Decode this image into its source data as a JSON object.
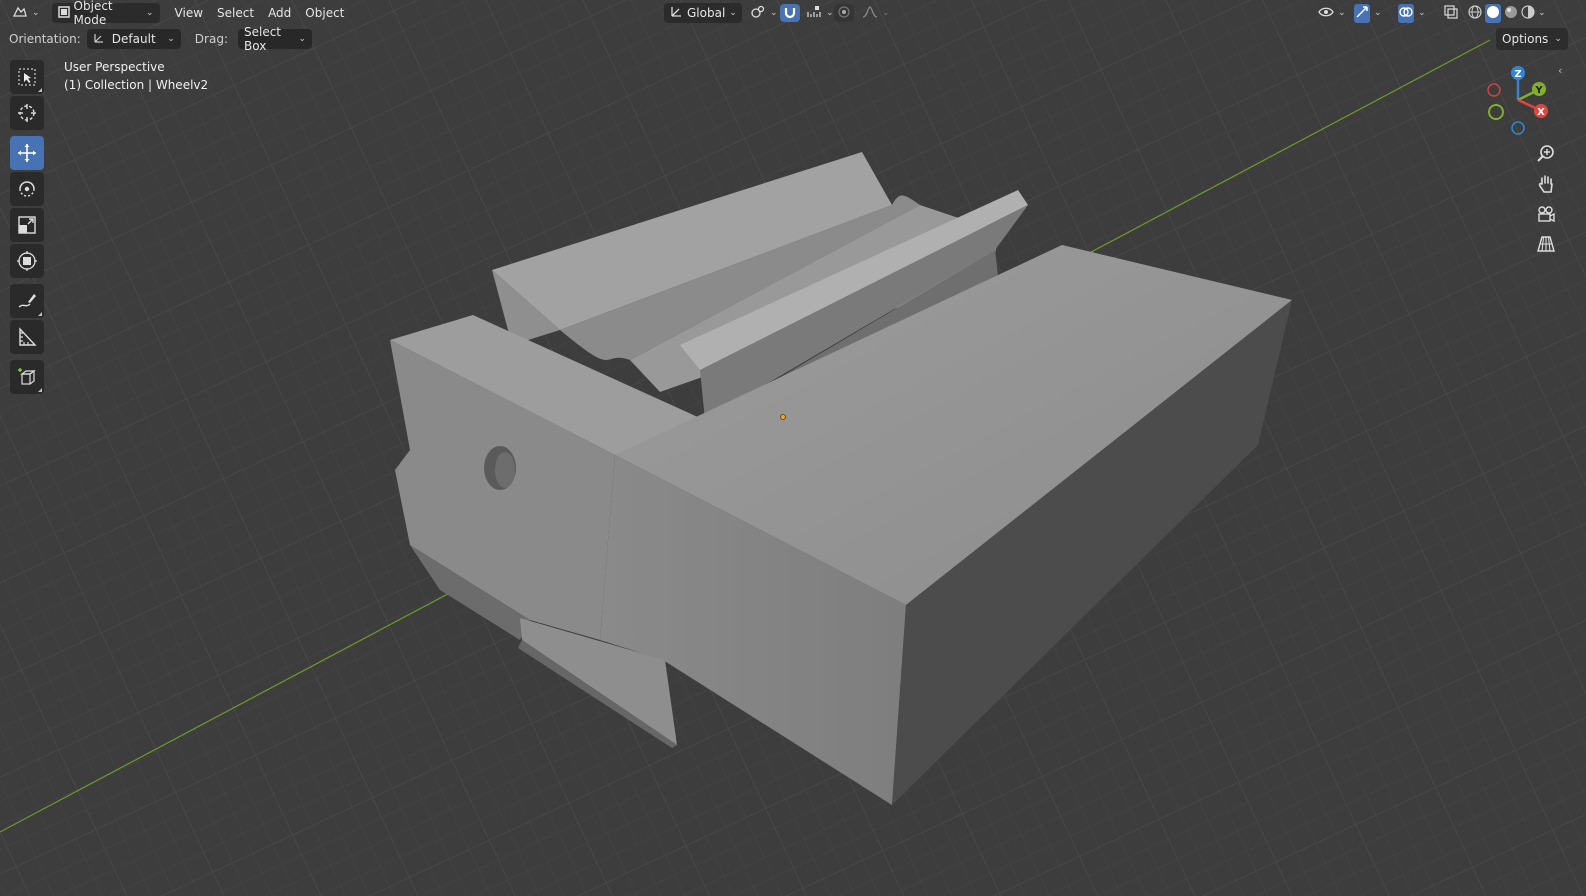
{
  "header": {
    "editor_type_icon": "editor-type-icon",
    "mode_label": "Object Mode",
    "menus": [
      "View",
      "Select",
      "Add",
      "Object"
    ],
    "transform_orientation": "Global",
    "pivot_icon": "pivot-point-icon",
    "snap_icon": "snap-magnet-icon",
    "proportional_icon": "proportional-edit-icon"
  },
  "tool_settings": {
    "orientation_label": "Orientation:",
    "orientation_value": "Default",
    "drag_label": "Drag:",
    "drag_value": "Select Box",
    "options_label": "Options"
  },
  "viewport_info": {
    "perspective": "User Perspective",
    "collection": "(1) Collection | Wheelv2"
  },
  "toolbar": [
    {
      "name": "select-box-tool",
      "icon": "select-box-icon",
      "active": false
    },
    {
      "name": "cursor-tool",
      "icon": "cursor-icon",
      "active": false
    },
    {
      "name": "move-tool",
      "icon": "move-icon",
      "active": true
    },
    {
      "name": "rotate-tool",
      "icon": "rotate-icon",
      "active": false
    },
    {
      "name": "scale-tool",
      "icon": "scale-icon",
      "active": false
    },
    {
      "name": "transform-tool",
      "icon": "transform-icon",
      "active": false
    },
    {
      "name": "annotate-tool",
      "icon": "annotate-icon",
      "active": false
    },
    {
      "name": "measure-tool",
      "icon": "measure-icon",
      "active": false
    },
    {
      "name": "add-cube-tool",
      "icon": "add-cube-icon",
      "active": false
    }
  ],
  "gizmo": {
    "x_label": "X",
    "y_label": "Y",
    "z_label": "Z",
    "x_color": "#e0463f",
    "y_color": "#7fb02a",
    "z_color": "#2f86d6"
  },
  "colors": {
    "accent": "#4772b3",
    "grid_x_axis": "#7a9a2e",
    "viewport_bg": "#3f3f3f"
  }
}
